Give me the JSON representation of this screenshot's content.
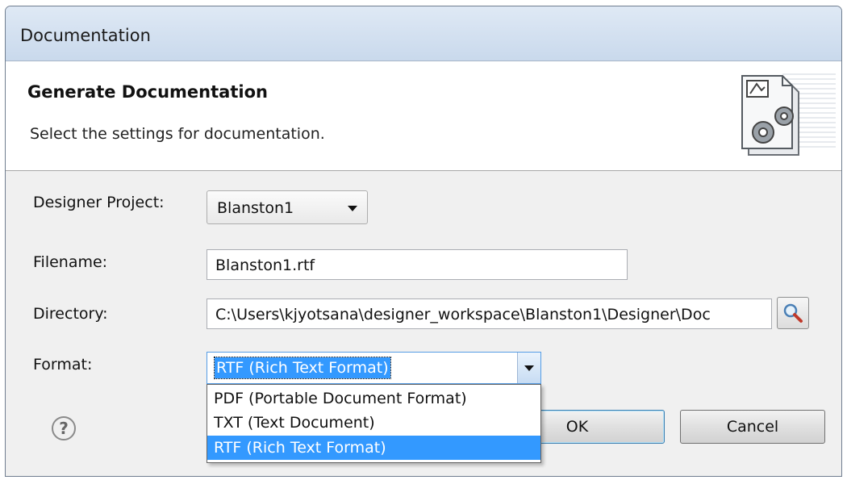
{
  "window": {
    "title": "Documentation"
  },
  "header": {
    "title": "Generate Documentation",
    "subtitle": "Select the settings for documentation.",
    "icon": "document-gears-icon"
  },
  "form": {
    "project_label": "Designer Project:",
    "project_value": "Blanston1",
    "filename_label": "Filename:",
    "filename_value": "Blanston1.rtf",
    "directory_label": "Directory:",
    "directory_value": "C:\\Users\\kjyotsana\\designer_workspace\\Blanston1\\Designer\\Doc",
    "format_label": "Format:",
    "format_value": "RTF (Rich Text Format)",
    "format_options": [
      "PDF (Portable Document Format)",
      "TXT (Text Document)",
      "RTF (Rich Text Format)"
    ]
  },
  "footer": {
    "help_icon": "question-mark-icon",
    "ok_label": "OK",
    "cancel_label": "Cancel"
  },
  "colors": {
    "selection": "#3399ff",
    "titlebar": "#c9d9ec",
    "dialog_bg": "#f0f0f0"
  }
}
